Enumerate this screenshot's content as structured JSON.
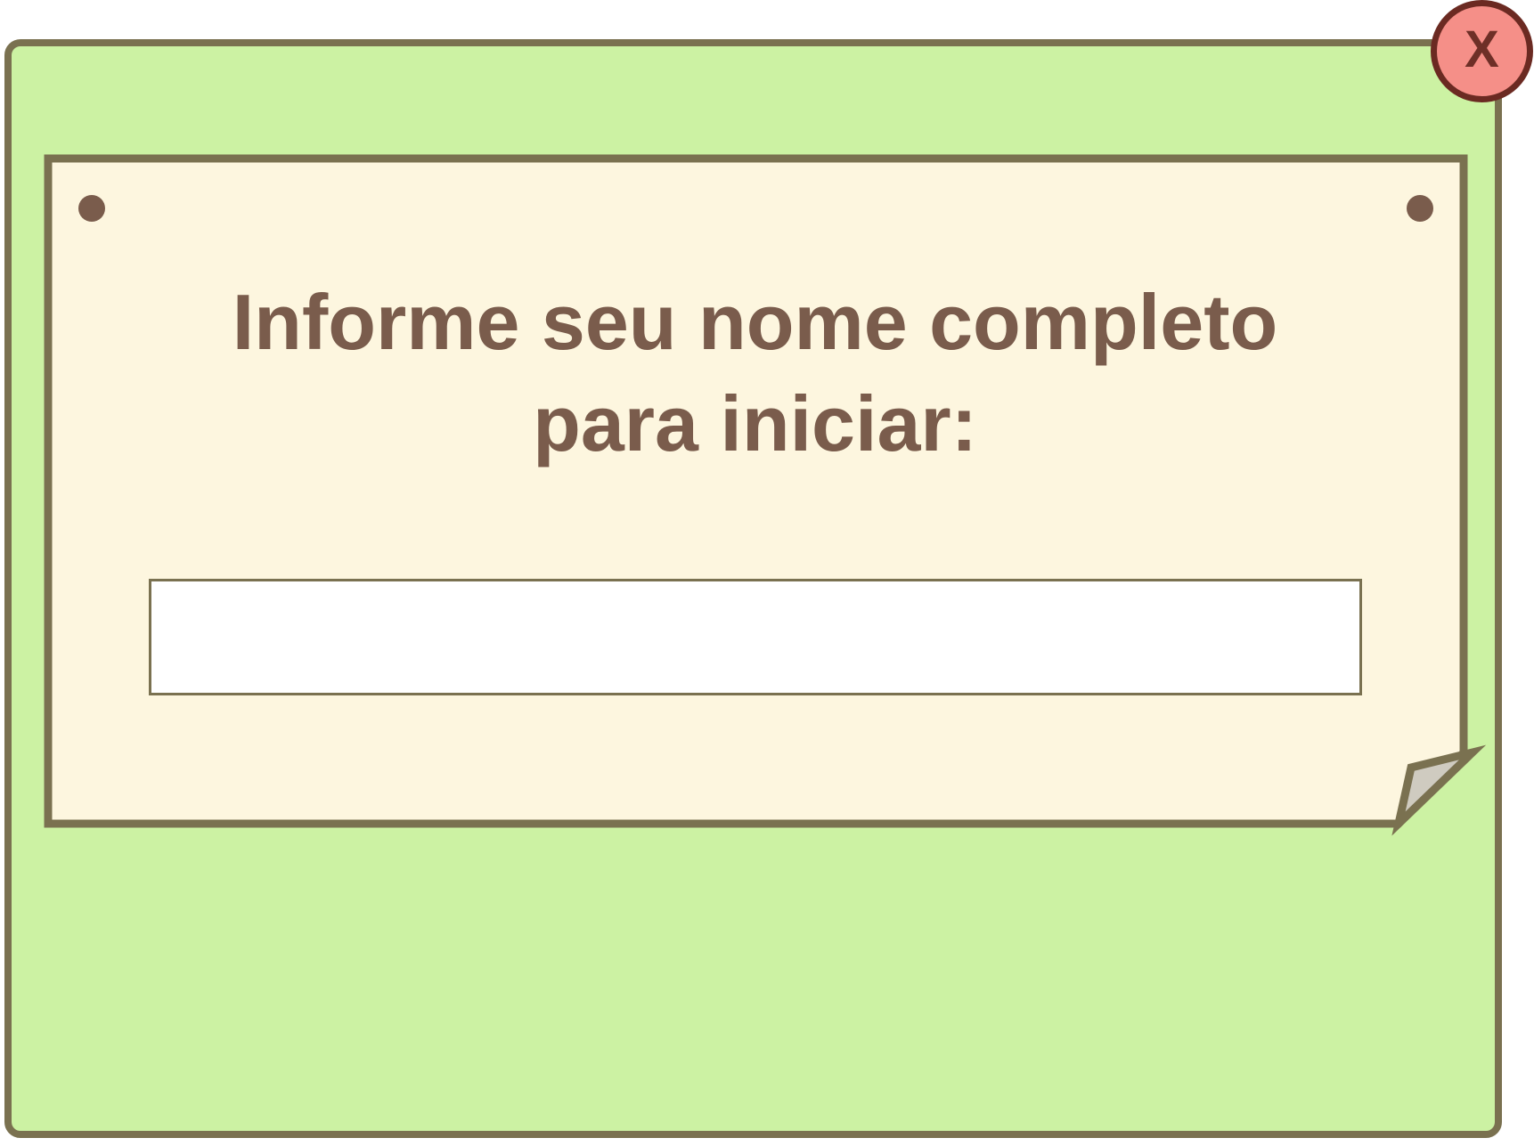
{
  "dialog": {
    "prompt": "Informe seu nome completo\npara iniciar:",
    "close_label": "X",
    "name_input": {
      "value": "",
      "placeholder": ""
    }
  },
  "colors": {
    "panel_background": "#ccf2a3",
    "panel_border": "#7a7150",
    "note_background": "#fdf6df",
    "text": "#7a5c4c",
    "close_button": "#f58f88",
    "close_border": "#6b2a22",
    "page_curl": "#cfcbc0"
  },
  "icons": {
    "close": "close-icon",
    "pins": "pushpin-icon"
  }
}
